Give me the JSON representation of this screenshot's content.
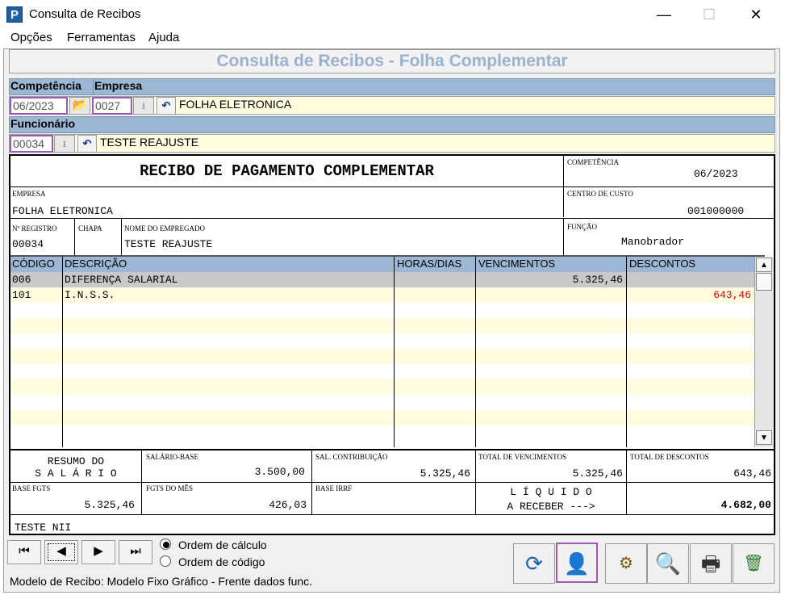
{
  "window": {
    "title": "Consulta de Recibos",
    "app_icon_letter": "P",
    "minimize": "—",
    "maximize": "☐",
    "close": "✕"
  },
  "menu": [
    "Opções",
    "Ferramentas",
    "Ajuda"
  ],
  "banner": "Consulta de Recibos - Folha Complementar",
  "filters": {
    "competencia_label": "Competência",
    "empresa_label": "Empresa",
    "competencia_value": "06/2023",
    "empresa_code": "0027",
    "empresa_name": "FOLHA ELETRONICA",
    "funcionario_label": "Funcionário",
    "funcionario_code": "00034",
    "funcionario_name": "TESTE REAJUSTE"
  },
  "receipt": {
    "title": "RECIBO DE PAGAMENTO COMPLEMENTAR",
    "competencia_label": "COMPETÊNCIA",
    "competencia": "06/2023",
    "empresa_label": "EMPRESA",
    "empresa": "FOLHA ELETRONICA",
    "centro_label": "CENTRO DE CUSTO",
    "centro": "001000000",
    "registro_label": "Nº REGISTRO",
    "registro": "00034",
    "chapa_label": "CHAPA",
    "nome_label": "NOME DO EMPREGADO",
    "nome": "TESTE REAJUSTE",
    "funcao_label": "FUNÇÃO",
    "funcao": "Manobrador",
    "columns": [
      "CÓDIGO",
      "DESCRIÇÃO",
      "HORAS/DIAS",
      "VENCIMENTOS",
      "DESCONTOS"
    ],
    "rows": [
      {
        "codigo": "006",
        "descricao": "DIFERENÇA SALARIAL",
        "horas": "",
        "vencimentos": "5.325,46",
        "descontos": ""
      },
      {
        "codigo": "101",
        "descricao": "I.N.S.S.",
        "horas": "",
        "vencimentos": "",
        "descontos": "643,46"
      }
    ],
    "resumo_line1": "RESUMO DO",
    "resumo_line2": "S A L Á R I O",
    "salario_base_label": "SALÁRIO-BASE",
    "salario_base": "3.500,00",
    "sal_contrib_label": "SAL. CONTRIBUIÇÃO",
    "sal_contrib": "5.325,46",
    "total_venc_label": "TOTAL DE VENCIMENTOS",
    "total_venc": "5.325,46",
    "total_desc_label": "TOTAL DE DESCONTOS",
    "total_desc": "643,46",
    "base_fgts_label": "BASE FGTS",
    "base_fgts": "5.325,46",
    "fgts_mes_label": "FGTS DO MÊS",
    "fgts_mes": "426,03",
    "base_irrf_label": "BASE IRRF",
    "liquido_line1": "L Í Q U I D O",
    "liquido_line2": "A RECEBER --->",
    "liquido": "4.682,00",
    "footer_note": "TESTE NII"
  },
  "nav": {
    "first": "⏮",
    "prev": "◀",
    "next": "▶",
    "last": "⏭"
  },
  "order": {
    "option1": "Ordem de cálculo",
    "option2": "Ordem de código",
    "selected": "option1"
  },
  "status": "Modelo de Recibo: Modelo Fixo Gráfico - Frente dados func.",
  "colors": {
    "header_blue": "#9bb7d4",
    "field_yellow": "#fffce0",
    "highlight_purple": "#9b59b6",
    "negative_red": "#e00000"
  }
}
